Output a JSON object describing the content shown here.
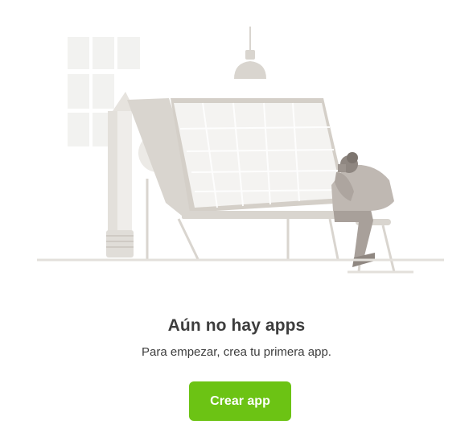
{
  "empty_state": {
    "title": "Aún no hay apps",
    "subtitle": "Para empezar, crea tu primera app.",
    "create_button_label": "Crear app",
    "illustration": "designer-at-drafting-table-illustration"
  },
  "colors": {
    "accent": "#6cc314",
    "text": "#3d3d3d",
    "illustration_light": "#f2f2f0",
    "illustration_mid": "#d9d5cf",
    "illustration_dark": "#b3aaa3"
  }
}
